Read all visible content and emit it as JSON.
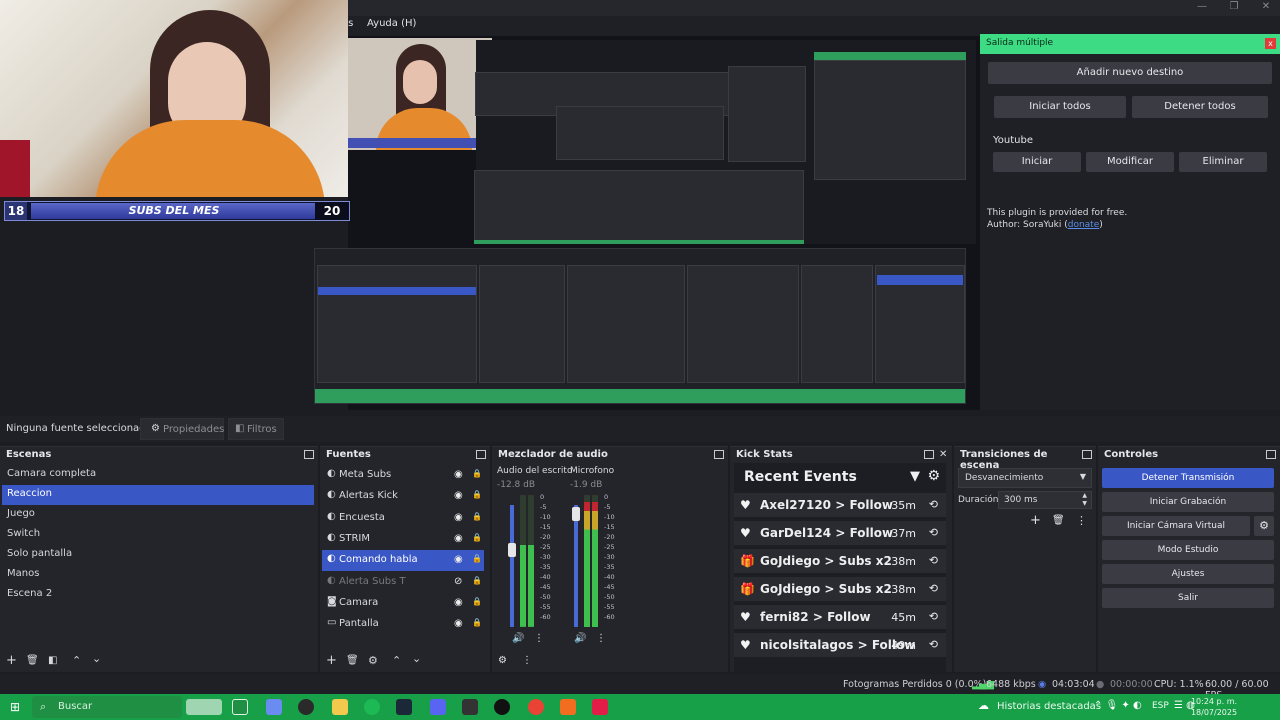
{
  "menu": {
    "item_partial": "as",
    "help": "Ayuda (H)"
  },
  "subs_banner": {
    "left_count": "18",
    "label": "SUBS DEL MES",
    "right_count": "20"
  },
  "multi_output": {
    "title": "Salida múltiple",
    "close": "x",
    "add_destination": "Añadir nuevo destino",
    "start_all": "Iniciar todos",
    "stop_all": "Detener todos",
    "destination_name": "Youtube",
    "start": "Iniciar",
    "modify": "Modificar",
    "delete": "Eliminar",
    "footer_line1": "This plugin is provided for free.",
    "footer_author": "Author: SoraYuki (",
    "footer_link": "donate",
    "footer_close": ")"
  },
  "source_bar": {
    "none_selected": "Ninguna fuente seleccionac",
    "properties": "Propiedades",
    "filters": "Filtros"
  },
  "scenes": {
    "title": "Escenas",
    "items": [
      "Camara completa",
      "Reaccion",
      "Juego",
      "Switch",
      "Solo pantalla",
      "Manos",
      "Escena 2"
    ],
    "selected_index": 1
  },
  "sources": {
    "title": "Fuentes",
    "items": [
      {
        "label": "Meta Subs"
      },
      {
        "label": "Alertas Kick"
      },
      {
        "label": "Encuesta"
      },
      {
        "label": "STRIM"
      },
      {
        "label": "Comando habla"
      },
      {
        "label": "Alerta Subs T"
      },
      {
        "label": "Camara"
      },
      {
        "label": "Pantalla"
      }
    ],
    "selected_index": 4,
    "hidden_index": 5
  },
  "mixer": {
    "title": "Mezclador de audio",
    "channels": [
      {
        "name": "Audio del escrito",
        "db": "-12.8 dB",
        "level": 0.62
      },
      {
        "name": "Microfono",
        "db": "-1.9 dB",
        "level": 0.95
      }
    ],
    "scale": [
      "0",
      "-5",
      "-10",
      "-15",
      "-20",
      "-25",
      "-30",
      "-35",
      "-40",
      "-45",
      "-50",
      "-55",
      "-60"
    ]
  },
  "kick": {
    "title": "Kick Stats",
    "header": "Recent Events",
    "events": [
      {
        "icon": "heart",
        "user": "Axel27120",
        "action": "Follow",
        "time": "35m"
      },
      {
        "icon": "heart",
        "user": "GarDel124",
        "action": "Follow",
        "time": "37m"
      },
      {
        "icon": "gift",
        "user": "GoJdiego",
        "action": "Subs x2",
        "time": "38m"
      },
      {
        "icon": "gift",
        "user": "GoJdiego",
        "action": "Subs x2",
        "time": "38m"
      },
      {
        "icon": "heart",
        "user": "ferni82",
        "action": "Follow",
        "time": "45m"
      },
      {
        "icon": "heart",
        "user": "nicolsitalagos",
        "action": "Follow",
        "time": "49m"
      }
    ]
  },
  "transitions": {
    "title": "Transiciones de escena",
    "selected": "Desvanecimiento",
    "duration_label": "Duración",
    "duration_value": "300 ms"
  },
  "controls": {
    "title": "Controles",
    "stop_stream": "Detener Transmisión",
    "start_recording": "Iniciar Grabación",
    "virtual_cam": "Iniciar Cámara Virtual",
    "studio_mode": "Modo Estudio",
    "settings": "Ajustes",
    "exit": "Salir"
  },
  "status": {
    "dropped": "Fotogramas Perdidos 0 (0.0%)",
    "bitrate": "6488 kbps",
    "stream_time": "04:03:04",
    "rec_time": "00:00:00",
    "cpu": "CPU: 1.1%",
    "fps": "60.00 / 60.00 FPS"
  },
  "taskbar": {
    "search": "Buscar",
    "news": "Historias destacadas",
    "lang": "ESP",
    "time": "10:24 p. m.",
    "date": "18/07/2025"
  },
  "colors": {
    "accent": "#3a57c6",
    "dialog_title": "#3ddc84",
    "taskbar": "#18a049"
  }
}
